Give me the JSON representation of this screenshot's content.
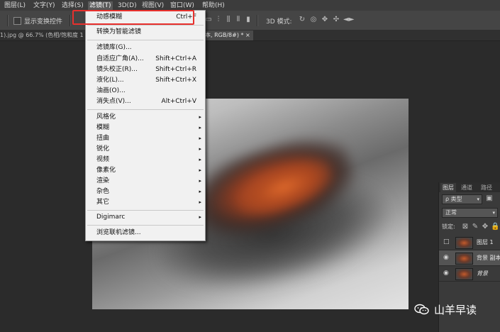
{
  "menubar": {
    "items": [
      "图层(L)",
      "文字(Y)",
      "选择(S)",
      "滤镜(T)",
      "3D(D)",
      "视图(V)",
      "窗口(W)",
      "帮助(H)"
    ]
  },
  "options_bar": {
    "checkbox_label": "显示变换控件",
    "mode_3d_label": "3D 模式:"
  },
  "tabs": {
    "left": "1).jpg @ 66.7% (色相/饱和度 1",
    "right": "本, RGB/8#) * ×"
  },
  "filter_menu": {
    "items": [
      {
        "label": "动感模糊",
        "shortcut": "Ctrl+F"
      },
      {
        "label": "转换为智能滤镜",
        "shortcut": ""
      },
      {
        "label": "滤镜库(G)...",
        "shortcut": ""
      },
      {
        "label": "自适应广角(A)...",
        "shortcut": "Shift+Ctrl+A"
      },
      {
        "label": "镜头校正(R)...",
        "shortcut": "Shift+Ctrl+R"
      },
      {
        "label": "液化(L)...",
        "shortcut": "Shift+Ctrl+X"
      },
      {
        "label": "油画(O)...",
        "shortcut": ""
      },
      {
        "label": "消失点(V)...",
        "shortcut": "Alt+Ctrl+V"
      },
      {
        "label": "风格化",
        "shortcut": ""
      },
      {
        "label": "模糊",
        "shortcut": ""
      },
      {
        "label": "扭曲",
        "shortcut": ""
      },
      {
        "label": "锐化",
        "shortcut": ""
      },
      {
        "label": "视频",
        "shortcut": ""
      },
      {
        "label": "像素化",
        "shortcut": ""
      },
      {
        "label": "渲染",
        "shortcut": ""
      },
      {
        "label": "杂色",
        "shortcut": ""
      },
      {
        "label": "其它",
        "shortcut": ""
      },
      {
        "label": "Digimarc",
        "shortcut": ""
      },
      {
        "label": "浏览联机滤镜...",
        "shortcut": ""
      }
    ],
    "submenu_arrow": "▸"
  },
  "layers_panel": {
    "tabs": [
      "图层",
      "通道",
      "路径"
    ],
    "kind_filter": "ρ 类型",
    "blend_mode": "正常",
    "lock_label": "锁定:",
    "layers": [
      {
        "name": "图层 1",
        "selected": false,
        "visible": false
      },
      {
        "name": "背景 副本",
        "selected": true,
        "visible": true
      },
      {
        "name": "背景",
        "selected": false,
        "visible": true
      }
    ]
  },
  "watermark": {
    "text": "山羊早读",
    "icon": "wechat-icon"
  },
  "colors": {
    "highlight_box": "#e8302d",
    "menu_bg": "#f1f1f1",
    "app_bg": "#2b2b2b"
  }
}
